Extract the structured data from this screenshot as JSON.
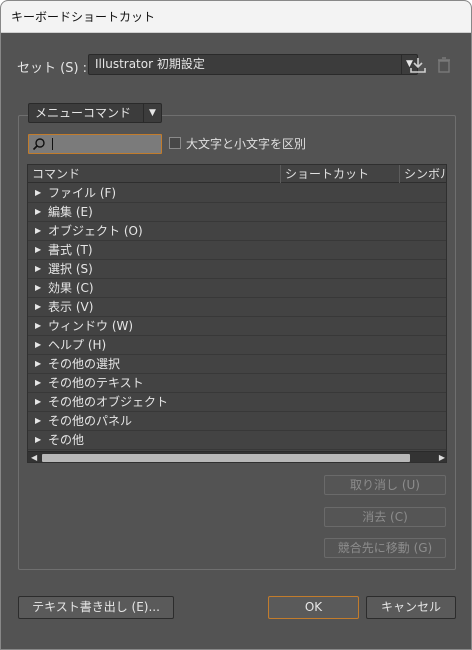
{
  "window": {
    "title": "キーボードショートカット"
  },
  "set": {
    "label": "セット (S) :",
    "value": "Illustrator 初期設定"
  },
  "icons": {
    "save": "save-icon",
    "delete": "trash-icon"
  },
  "command_type": {
    "value": "メニューコマンド"
  },
  "search": {
    "value": "",
    "case_label": "大文字と小文字を区別"
  },
  "table": {
    "headers": [
      "コマンド",
      "ショートカット",
      "シンボル"
    ],
    "rows": [
      "ファイル (F)",
      "編集 (E)",
      "オブジェクト (O)",
      "書式 (T)",
      "選択 (S)",
      "効果 (C)",
      "表示 (V)",
      "ウィンドウ (W)",
      "ヘルプ (H)",
      "その他の選択",
      "その他のテキスト",
      "その他のオブジェクト",
      "その他のパネル",
      "その他"
    ]
  },
  "buttons": {
    "undo": "取り消し (U)",
    "clear": "消去 (C)",
    "goto_conflict": "競合先に移動 (G)",
    "export_text": "テキスト書き出し (E)...",
    "ok": "OK",
    "cancel": "キャンセル"
  },
  "colors": {
    "panel": "#535353",
    "accent_border": "#c27c2c"
  }
}
